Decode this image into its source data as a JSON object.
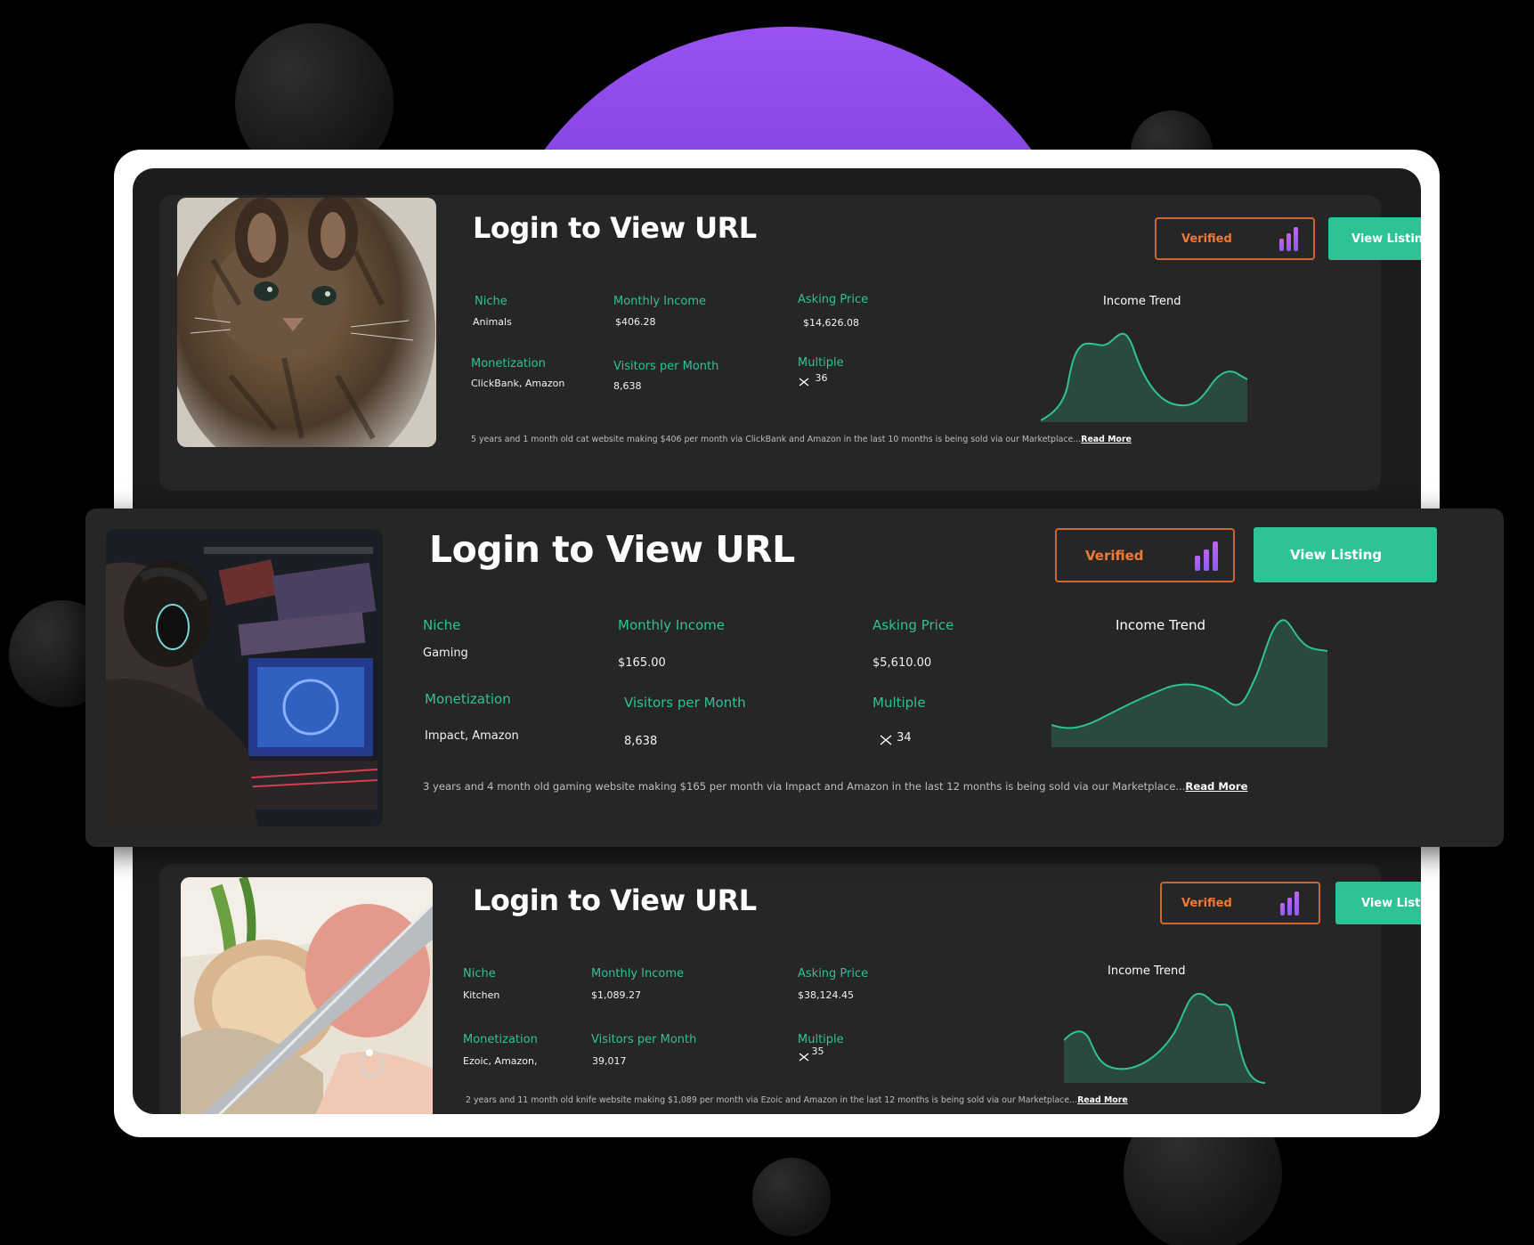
{
  "colors": {
    "accent": "#2ec297",
    "verified": "#f07a35",
    "bars": "#9a5cf5",
    "card": "#262626",
    "background": "#000000"
  },
  "listings": [
    {
      "image": "kitten",
      "title": "Login to View URL",
      "badge": "Verified",
      "button": "View Listing",
      "niche_label": "Niche",
      "niche": "Animals",
      "income_label": "Monthly Income",
      "income": "$406.28",
      "price_label": "Asking Price",
      "price": "$14,626.08",
      "monetization_label": "Monetization",
      "monetization": "ClickBank, Amazon",
      "visitors_label": "Visitors per Month",
      "visitors": "8,638",
      "multiple_label": "Multiple",
      "multiple": "36",
      "trend_title": "Income Trend",
      "description": "5 years and 1 month old cat website making $406 per month via ClickBank and Amazon  in the last 10 months is being sold via our Marketplace...",
      "read_more": "Read More"
    },
    {
      "image": "gamer",
      "title": "Login to View URL",
      "badge": "Verified",
      "button": "View Listing",
      "niche_label": "Niche",
      "niche": "Gaming",
      "income_label": "Monthly Income",
      "income": "$165.00",
      "price_label": "Asking Price",
      "price": "$5,610.00",
      "monetization_label": "Monetization",
      "monetization": "Impact, Amazon",
      "visitors_label": "Visitors per Month",
      "visitors": "8,638",
      "multiple_label": "Multiple",
      "multiple": "34",
      "trend_title": "Income Trend",
      "description": "3 years and 4 month old gaming website making $165 per month via Impact and Amazon  in the last 12 months is being sold via our Marketplace...",
      "read_more": "Read More"
    },
    {
      "image": "knife",
      "title": "Login to View URL",
      "badge": "Verified",
      "button": "View Listing",
      "niche_label": "Niche",
      "niche": "Kitchen",
      "income_label": "Monthly Income",
      "income": "$1,089.27",
      "price_label": "Asking Price",
      "price": "$38,124.45",
      "monetization_label": "Monetization",
      "monetization": "Ezoic, Amazon,",
      "visitors_label": "Visitors per Month",
      "visitors": "39,017",
      "multiple_label": "Multiple",
      "multiple": "35",
      "trend_title": "Income Trend",
      "description": "2 years and 11 month old knife website making $1,089 per month via Ezoic and Amazon  in the last 12 months is being sold via our Marketplace...",
      "read_more": "Read More"
    }
  ]
}
